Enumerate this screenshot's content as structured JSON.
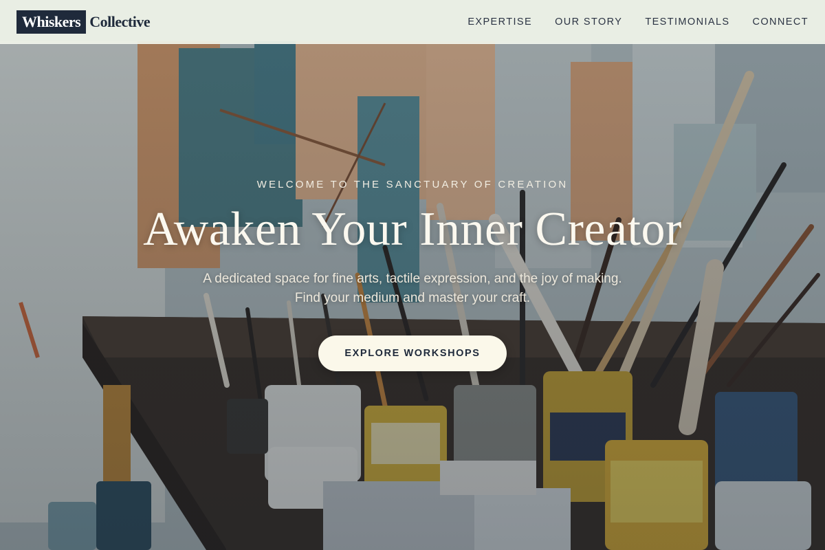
{
  "brand": {
    "logo_box_text": "Whiskers",
    "logo_tail_text": "Collective"
  },
  "nav": {
    "items": [
      {
        "label": "EXPERTISE"
      },
      {
        "label": "OUR STORY"
      },
      {
        "label": "TESTIMONIALS"
      },
      {
        "label": "CONNECT"
      }
    ]
  },
  "hero": {
    "eyebrow": "WELCOME TO THE SANCTUARY OF CREATION",
    "headline": "Awaken Your Inner Creator",
    "subtext": "A dedicated space for fine arts, tactile expression, and the joy of making. Find your medium and master your craft.",
    "cta_label": "EXPLORE WORKSHOPS"
  },
  "colors": {
    "header_bg": "#f0f4ea",
    "brand_dark": "#1f2a3b",
    "cta_bg": "#fbf8ea",
    "hero_text": "#fbf8ef"
  }
}
